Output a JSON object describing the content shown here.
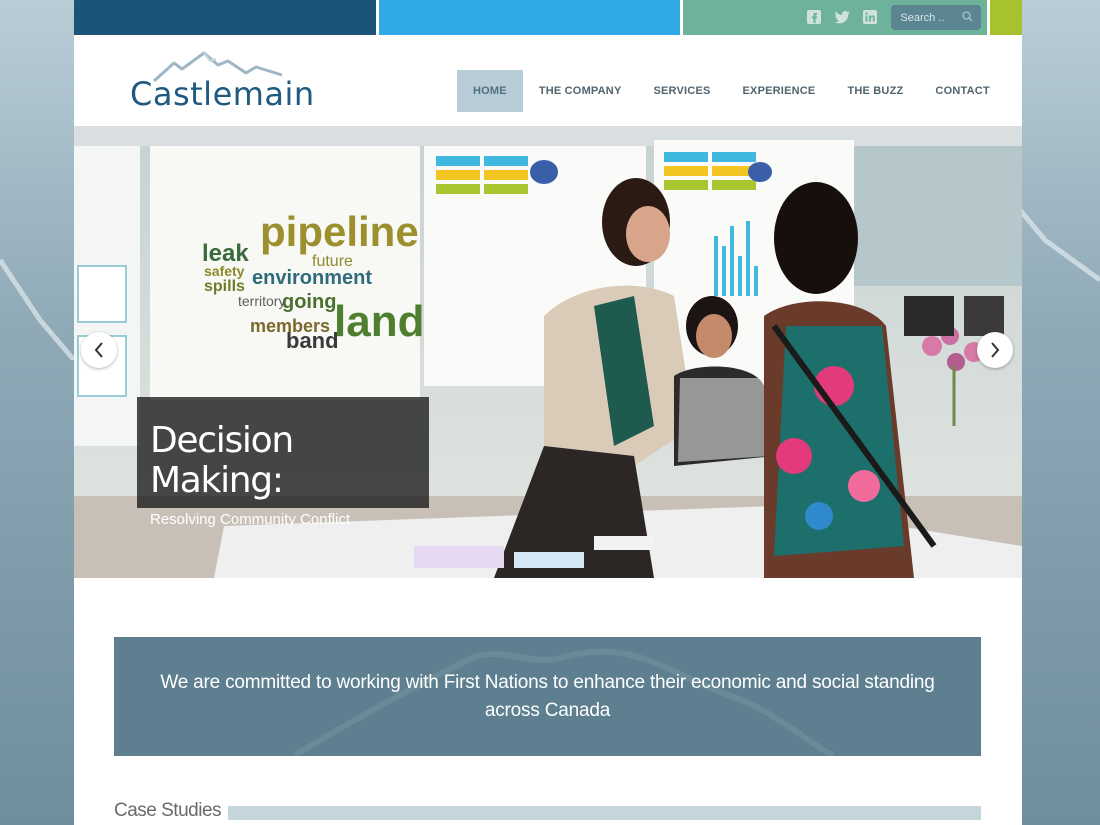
{
  "colors": {
    "top_bar_1": "#1c5378",
    "top_bar_2": "#30a9e6",
    "top_bar_3": "#6fb29b",
    "top_bar_4": "#a6c32d",
    "nav_active_bg": "#b8cdd8",
    "mission_bg": "#5d7f8f",
    "logo_color": "#1f5a80"
  },
  "social": {
    "icons": [
      "facebook-icon",
      "twitter-icon",
      "linkedin-icon"
    ]
  },
  "search": {
    "placeholder": "Search .."
  },
  "logo": {
    "text": "Castlemain"
  },
  "nav": {
    "items": [
      {
        "label": "HOME",
        "active": true
      },
      {
        "label": "THE COMPANY"
      },
      {
        "label": "SERVICES"
      },
      {
        "label": "EXPERIENCE"
      },
      {
        "label": "THE BUZZ"
      },
      {
        "label": "CONTACT"
      }
    ]
  },
  "hero": {
    "title": "Decision Making:",
    "subtitle": "Resolving Community Conflict",
    "poster_words": [
      "pipeline",
      "environment",
      "land",
      "leak",
      "members",
      "band",
      "going",
      "spills",
      "safety",
      "territory",
      "future"
    ]
  },
  "mission": {
    "text": "We are committed to working with First Nations to enhance their economic and social standing across Canada"
  },
  "case_studies": {
    "title": "Case Studies"
  }
}
